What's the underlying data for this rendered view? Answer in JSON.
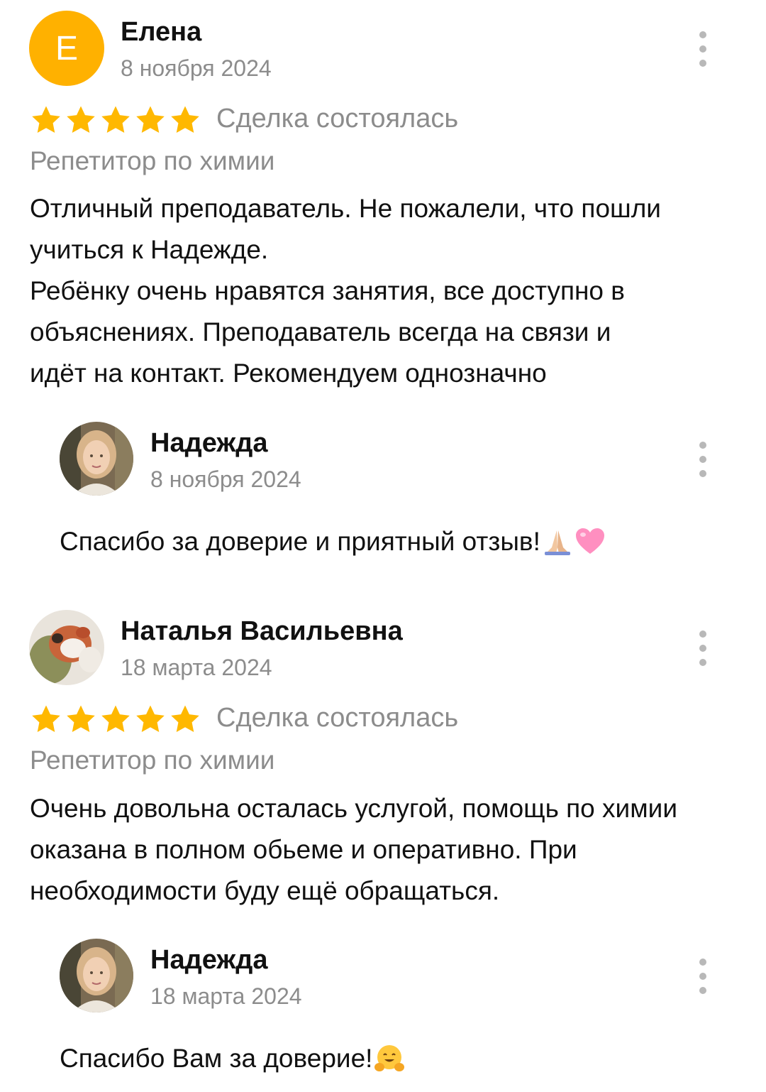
{
  "reviews": [
    {
      "author": "Елена",
      "avatar_letter": "Е",
      "avatar_color": "#ffb100",
      "date": "8 ноября 2024",
      "rating": 5,
      "deal_status": "Сделка состоялась",
      "service": "Репетитор по химии",
      "text_lines": [
        "Отличный преподаватель. Не пожалели, что пошли",
        "учиться к Надежде.",
        "Ребёнку очень нравятся занятия, все доступно в",
        "объяснениях. Преподаватель всегда на связи и",
        "идёт на контакт. Рекомендуем однозначно"
      ],
      "reply": {
        "author": "Надежда",
        "date": "8 ноября 2024",
        "text": "Спасибо за доверие и приятный отзыв!",
        "emoji_icons": [
          "praying-hands-icon",
          "pink-heart-icon"
        ]
      }
    },
    {
      "author": "Наталья Васильевна",
      "date": "18 марта 2024",
      "rating": 5,
      "deal_status": "Сделка состоялась",
      "service": "Репетитор по химии",
      "text_lines": [
        "Очень довольна осталась услугой, помощь по химии",
        "оказана в полном обьеме и оперативно. При",
        "необходимости буду ещё обращаться."
      ],
      "reply": {
        "author": "Надежда",
        "date": "18 марта 2024",
        "text": "Спасибо Вам за доверие!",
        "emoji_icons": [
          "hugging-face-icon"
        ]
      }
    }
  ],
  "colors": {
    "star": "#ffb800",
    "muted_text": "#8c8c8c",
    "more_dots": "#b8b8b8"
  },
  "icons": {
    "more": "more-vertical-icon",
    "star": "star-icon"
  }
}
